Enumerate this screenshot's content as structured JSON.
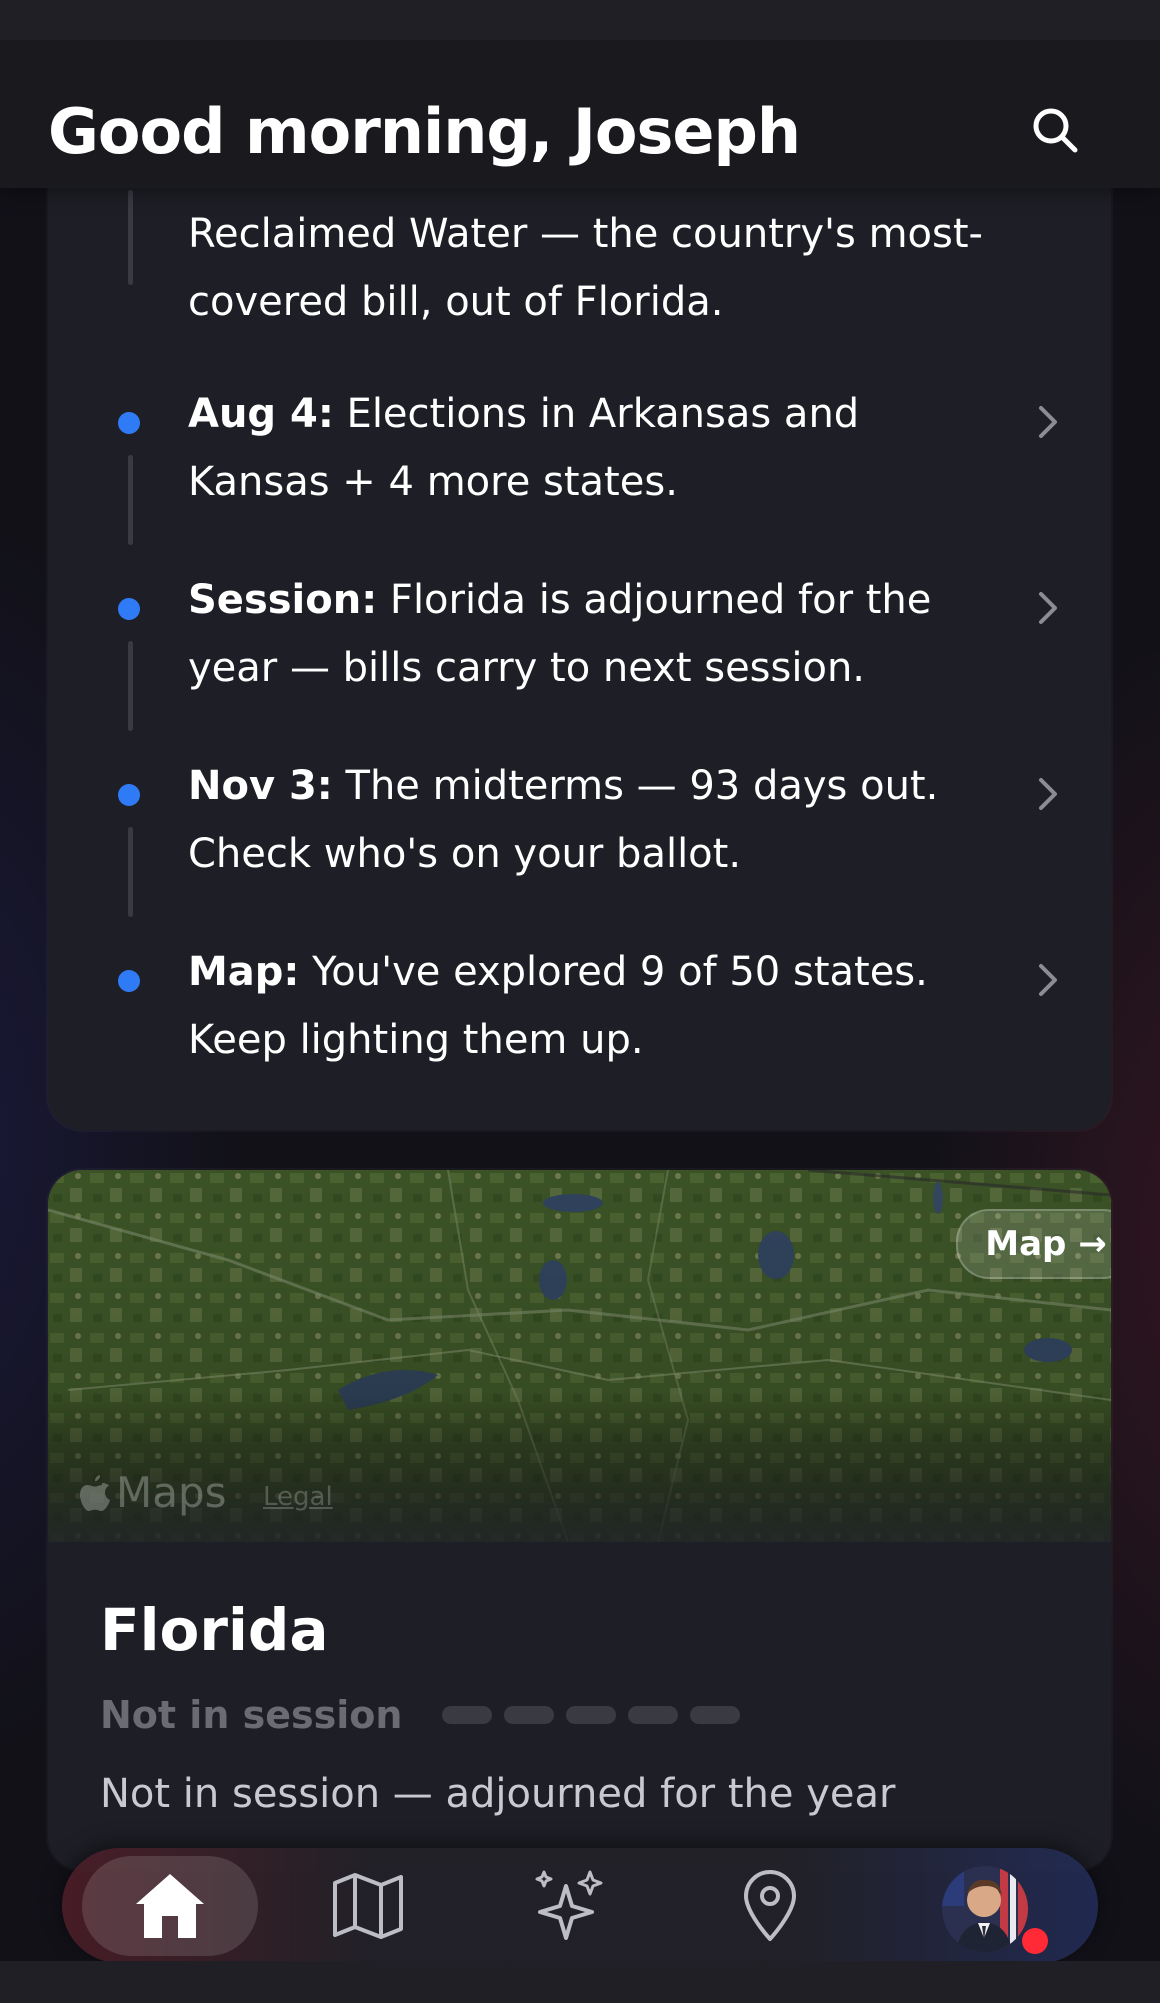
{
  "header": {
    "greeting": "Good morning, Joseph"
  },
  "feed": {
    "partial_text": "Reclaimed Water — the country's most-covered bill, out of Florida.",
    "items": [
      {
        "label": "Aug 4:",
        "text": " Elections in Arkansas and Kansas + 4 more states."
      },
      {
        "label": "Session:",
        "text": " Florida is adjourned for the year — bills carry to next session."
      },
      {
        "label": "Nov 3:",
        "text": " The midterms — 93 days out. Check who's on your ballot."
      },
      {
        "label": "Map:",
        "text": " You've explored 9 of 50 states. Keep lighting them up."
      }
    ]
  },
  "state_card": {
    "map_button": "Map →",
    "maps_attribution": "Maps",
    "legal_link": "Legal",
    "state_name": "Florida",
    "status": "Not in session",
    "description": "Not in session — adjourned for the year"
  },
  "tabbar": {
    "tabs": [
      {
        "id": "home",
        "icon": "home-icon",
        "active": true
      },
      {
        "id": "map",
        "icon": "map-icon",
        "active": false
      },
      {
        "id": "ai",
        "icon": "sparkles-icon",
        "active": false
      },
      {
        "id": "location",
        "icon": "location-pin-icon",
        "active": false
      },
      {
        "id": "profile",
        "icon": "avatar",
        "active": false
      }
    ]
  },
  "colors": {
    "accent_dot": "#2f7bf6",
    "notification_badge": "#ff2a35",
    "card_bg": "#1e1f26"
  }
}
